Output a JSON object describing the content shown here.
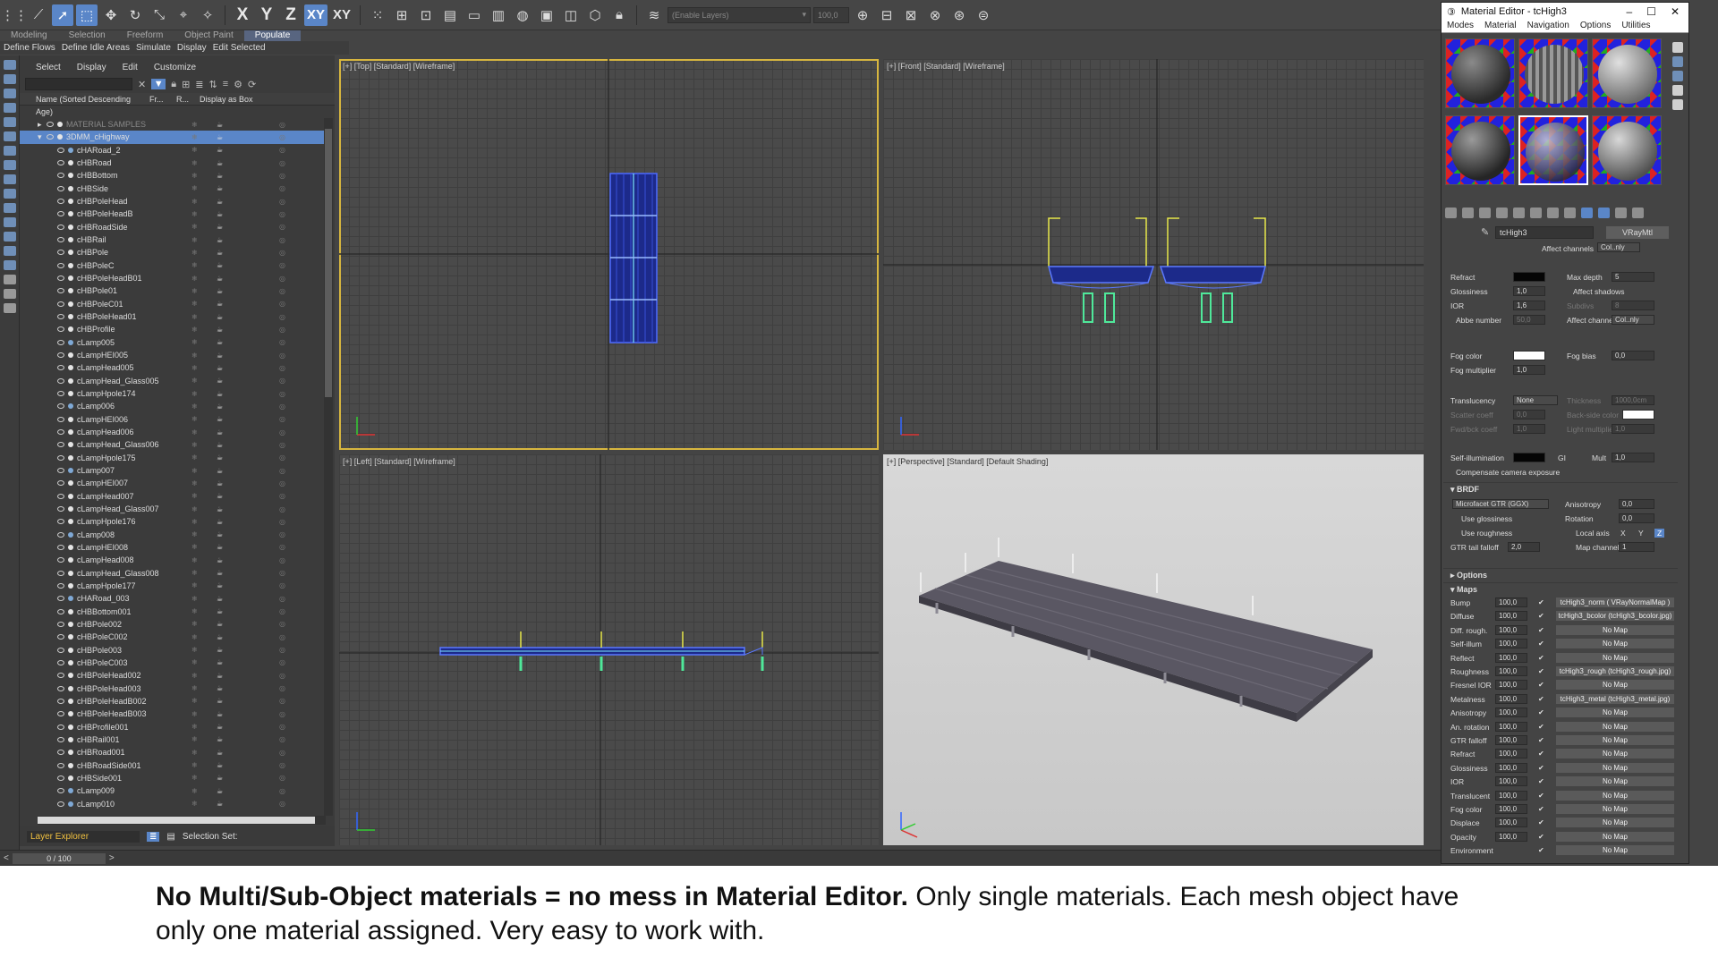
{
  "ribbon": {
    "tabs": [
      "Modeling",
      "Selection",
      "Freeform",
      "Object Paint",
      "Populate"
    ],
    "active_tab": "Populate",
    "row_items": [
      "Define Flows",
      "Define Idle Areas",
      "Simulate",
      "Display",
      "Edit Selected"
    ]
  },
  "toolbar": {
    "axis_x": "X",
    "axis_y": "Y",
    "axis_z": "Z",
    "axis_xy": "XY",
    "axis_xy2": "XY",
    "layer_combo": "(Enable Layers)",
    "value_field": "100,0"
  },
  "explorer": {
    "menu": [
      "Select",
      "Display",
      "Edit",
      "Customize"
    ],
    "columns": [
      "Name (Sorted Descending Age)",
      "Fr...",
      "R...",
      "Display as Box"
    ],
    "rows": [
      {
        "name": "MATERIAL SAMPLES",
        "level": 0,
        "type": "group"
      },
      {
        "name": "3DMM_cHighway",
        "level": 0,
        "type": "group",
        "selected": true
      },
      {
        "name": "cHARoad_2",
        "level": 1,
        "type": "lamp"
      },
      {
        "name": "cHBRoad",
        "level": 1,
        "type": "obj"
      },
      {
        "name": "cHBBottom",
        "level": 1,
        "type": "obj"
      },
      {
        "name": "cHBSide",
        "level": 1,
        "type": "obj"
      },
      {
        "name": "cHBPoleHead",
        "level": 1,
        "type": "obj"
      },
      {
        "name": "cHBPoleHeadB",
        "level": 1,
        "type": "obj"
      },
      {
        "name": "cHBRoadSide",
        "level": 1,
        "type": "obj"
      },
      {
        "name": "cHBRail",
        "level": 1,
        "type": "obj"
      },
      {
        "name": "cHBPole",
        "level": 1,
        "type": "obj"
      },
      {
        "name": "cHBPoleC",
        "level": 1,
        "type": "obj"
      },
      {
        "name": "cHBPoleHeadB01",
        "level": 1,
        "type": "obj"
      },
      {
        "name": "cHBPole01",
        "level": 1,
        "type": "obj"
      },
      {
        "name": "cHBPoleC01",
        "level": 1,
        "type": "obj"
      },
      {
        "name": "cHBPoleHead01",
        "level": 1,
        "type": "obj"
      },
      {
        "name": "cHBProfile",
        "level": 1,
        "type": "obj"
      },
      {
        "name": "cLamp005",
        "level": 1,
        "type": "lamp"
      },
      {
        "name": "cLampHEI005",
        "level": 1,
        "type": "obj"
      },
      {
        "name": "cLampHead005",
        "level": 1,
        "type": "obj"
      },
      {
        "name": "cLampHead_Glass005",
        "level": 1,
        "type": "obj"
      },
      {
        "name": "cLampHpole174",
        "level": 1,
        "type": "obj"
      },
      {
        "name": "cLamp006",
        "level": 1,
        "type": "lamp"
      },
      {
        "name": "cLampHEI006",
        "level": 1,
        "type": "obj"
      },
      {
        "name": "cLampHead006",
        "level": 1,
        "type": "obj"
      },
      {
        "name": "cLampHead_Glass006",
        "level": 1,
        "type": "obj"
      },
      {
        "name": "cLampHpole175",
        "level": 1,
        "type": "obj"
      },
      {
        "name": "cLamp007",
        "level": 1,
        "type": "lamp"
      },
      {
        "name": "cLampHEI007",
        "level": 1,
        "type": "obj"
      },
      {
        "name": "cLampHead007",
        "level": 1,
        "type": "obj"
      },
      {
        "name": "cLampHead_Glass007",
        "level": 1,
        "type": "obj"
      },
      {
        "name": "cLampHpole176",
        "level": 1,
        "type": "obj"
      },
      {
        "name": "cLamp008",
        "level": 1,
        "type": "lamp"
      },
      {
        "name": "cLampHEI008",
        "level": 1,
        "type": "obj"
      },
      {
        "name": "cLampHead008",
        "level": 1,
        "type": "obj"
      },
      {
        "name": "cLampHead_Glass008",
        "level": 1,
        "type": "obj"
      },
      {
        "name": "cLampHpole177",
        "level": 1,
        "type": "obj"
      },
      {
        "name": "cHARoad_003",
        "level": 1,
        "type": "lamp"
      },
      {
        "name": "cHBBottom001",
        "level": 1,
        "type": "obj"
      },
      {
        "name": "cHBPole002",
        "level": 1,
        "type": "obj"
      },
      {
        "name": "cHBPoleC002",
        "level": 1,
        "type": "obj"
      },
      {
        "name": "cHBPole003",
        "level": 1,
        "type": "obj"
      },
      {
        "name": "cHBPoleC003",
        "level": 1,
        "type": "obj"
      },
      {
        "name": "cHBPoleHead002",
        "level": 1,
        "type": "obj"
      },
      {
        "name": "cHBPoleHead003",
        "level": 1,
        "type": "obj"
      },
      {
        "name": "cHBPoleHeadB002",
        "level": 1,
        "type": "obj"
      },
      {
        "name": "cHBPoleHeadB003",
        "level": 1,
        "type": "obj"
      },
      {
        "name": "cHBProfile001",
        "level": 1,
        "type": "obj"
      },
      {
        "name": "cHBRail001",
        "level": 1,
        "type": "obj"
      },
      {
        "name": "cHBRoad001",
        "level": 1,
        "type": "obj"
      },
      {
        "name": "cHBRoadSide001",
        "level": 1,
        "type": "obj"
      },
      {
        "name": "cHBSide001",
        "level": 1,
        "type": "obj"
      },
      {
        "name": "cLamp009",
        "level": 1,
        "type": "lamp"
      },
      {
        "name": "cLamp010",
        "level": 1,
        "type": "lamp"
      }
    ],
    "footer_layer": "Layer Explorer",
    "selection_set_label": "Selection Set:"
  },
  "timebar": {
    "frame": "0 / 100"
  },
  "viewports": [
    {
      "id": "top",
      "label": "[+] [Top] [Standard] [Wireframe]"
    },
    {
      "id": "front",
      "label": "[+] [Front] [Standard] [Wireframe]"
    },
    {
      "id": "left",
      "label": "[+] [Left] [Standard] [Wireframe]"
    },
    {
      "id": "persp",
      "label": "[+] [Perspective] [Standard] [Default Shading]"
    }
  ],
  "material_editor": {
    "title": "Material Editor - tcHigh3",
    "menu": [
      "Modes",
      "Material",
      "Navigation",
      "Options",
      "Utilities"
    ],
    "material_name": "tcHigh3",
    "material_type": "VRayMtl",
    "affect_channels_top": "Col..nly",
    "params": {
      "refract": "Refract",
      "glossiness": "Glossiness",
      "glossiness_val": "1,0",
      "ior": "IOR",
      "ior_val": "1,6",
      "abbe": "Abbe number",
      "abbe_val": "50,0",
      "max_depth": "Max depth",
      "max_depth_val": "5",
      "affect_shadows": "Affect shadows",
      "subdivs": "Subdivs",
      "subdivs_val": "8",
      "affect_channels": "Affect channels",
      "affect_channels_val": "Col..nly",
      "fog_color": "Fog color",
      "fog_bias": "Fog bias",
      "fog_bias_val": "0,0",
      "fog_multiplier": "Fog multiplier",
      "fog_multiplier_val": "1,0",
      "translucency": "Translucency",
      "translucency_val": "None",
      "thickness": "Thickness",
      "thickness_val": "1000,0cm",
      "scatter": "Scatter coeff",
      "scatter_val": "0,0",
      "backside": "Back-side color",
      "fwdbck": "Fwd/bck coeff",
      "fwdbck_val": "1,0",
      "light_mult": "Light multiplier",
      "light_mult_val": "1,0",
      "self_illum": "Self-illumination",
      "gi": "GI",
      "mult": "Mult",
      "mult_val": "1,0",
      "compensate": "Compensate camera exposure"
    },
    "brdf": {
      "title": "BRDF",
      "type": "Microfacet GTR (GGX)",
      "use_glossiness": "Use glossiness",
      "use_roughness": "Use roughness",
      "gtr_tail": "GTR tail falloff",
      "gtr_tail_val": "2,0",
      "anisotropy": "Anisotropy",
      "anisotropy_val": "0,0",
      "rotation": "Rotation",
      "rotation_val": "0,0",
      "local_axis": "Local axis",
      "axis_x": "X",
      "axis_y": "Y",
      "axis_z": "Z",
      "map_channel": "Map channel",
      "map_channel_val": "1"
    },
    "options_title": "Options",
    "maps_title": "Maps",
    "maps": [
      {
        "name": "Bump",
        "value": "100,0",
        "map": "tcHigh3_norm  ( VRayNormalMap )"
      },
      {
        "name": "Diffuse",
        "value": "100,0",
        "map": "tcHigh3_bcolor (tcHigh3_bcolor.jpg)"
      },
      {
        "name": "Diff. rough.",
        "value": "100,0",
        "map": "No Map"
      },
      {
        "name": "Self-illum",
        "value": "100,0",
        "map": "No Map"
      },
      {
        "name": "Reflect",
        "value": "100,0",
        "map": "No Map"
      },
      {
        "name": "Roughness",
        "value": "100,0",
        "map": "tcHigh3_rough (tcHigh3_rough.jpg)"
      },
      {
        "name": "Fresnel IOR",
        "value": "100,0",
        "map": "No Map"
      },
      {
        "name": "Metalness",
        "value": "100,0",
        "map": "tcHigh3_metal (tcHigh3_metal.jpg)"
      },
      {
        "name": "Anisotropy",
        "value": "100,0",
        "map": "No Map"
      },
      {
        "name": "An. rotation",
        "value": "100,0",
        "map": "No Map"
      },
      {
        "name": "GTR falloff",
        "value": "100,0",
        "map": "No Map"
      },
      {
        "name": "Refract",
        "value": "100,0",
        "map": "No Map"
      },
      {
        "name": "Glossiness",
        "value": "100,0",
        "map": "No Map"
      },
      {
        "name": "IOR",
        "value": "100,0",
        "map": "No Map"
      },
      {
        "name": "Translucent",
        "value": "100,0",
        "map": "No Map"
      },
      {
        "name": "Fog color",
        "value": "100,0",
        "map": "No Map"
      },
      {
        "name": "Displace",
        "value": "100,0",
        "map": "No Map"
      },
      {
        "name": "Opacity",
        "value": "100,0",
        "map": "No Map"
      },
      {
        "name": "Environment",
        "value": "",
        "map": "No Map"
      }
    ]
  },
  "caption": {
    "bold": "No Multi/Sub-Object materials = no mess in Material Editor.",
    "rest": " Only single materials. Each mesh object have",
    "line2": "only one material assigned. Very easy to work with."
  }
}
